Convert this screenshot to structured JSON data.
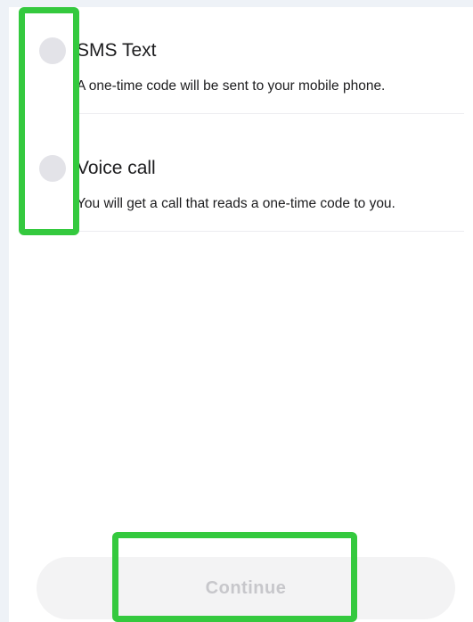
{
  "options": [
    {
      "title": "SMS Text",
      "description": "A one-time code will be sent to your mobile phone.",
      "selected": false
    },
    {
      "title": "Voice call",
      "description": "You will get a call that reads a one-time code to you.",
      "selected": false
    }
  ],
  "continue_button": {
    "label": "Continue",
    "enabled": false
  },
  "colors": {
    "highlight": "#34c93e",
    "radio_unselected": "#e3e3e8",
    "button_disabled_bg": "#f3f3f4",
    "button_disabled_text": "#c7c7cb"
  }
}
